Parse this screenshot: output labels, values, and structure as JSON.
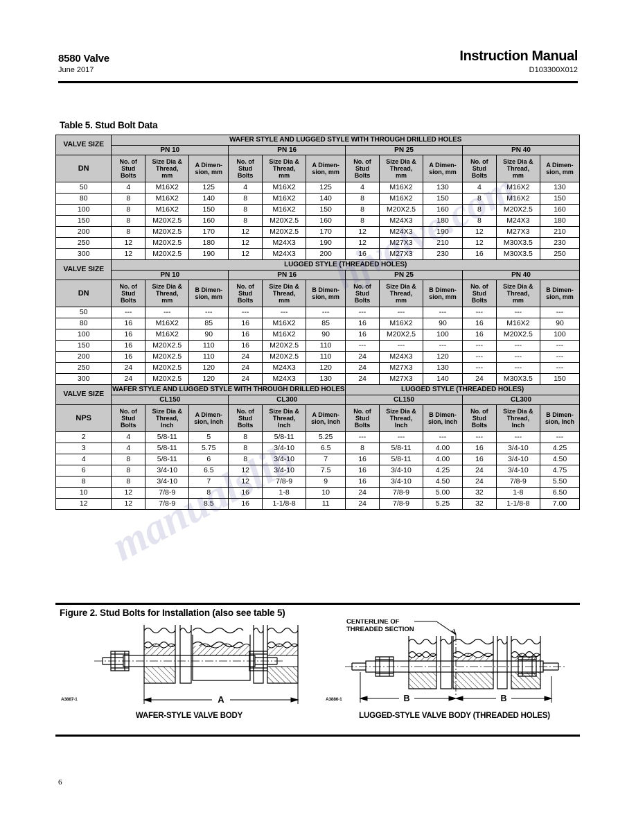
{
  "header": {
    "product": "8580 Valve",
    "date": "June 2017",
    "manual_title": "Instruction Manual",
    "doc_number": "D103300X012"
  },
  "table_caption": "Table 5. Stud Bolt Data",
  "labels": {
    "valve_size": "VALVE SIZE",
    "dn": "DN",
    "nps": "NPS",
    "no_of_stud_bolts": "No. of\nStud\nBolts",
    "size_dia_thread_mm": "Size Dia &\nThread,\nmm",
    "size_dia_thread_inch": "Size Dia &\nThread,\nInch",
    "a_dimension_mm": "A Dimen-\nsion, mm",
    "b_dimension_mm": "B Dimen-\nsion, mm",
    "a_dimension_inch": "A Dimen-\nsion, Inch",
    "b_dimension_inch": "B Dimen-\nsion, Inch",
    "banner_wafer_through": "WAFER STYLE AND LUGGED STYLE WITH THROUGH DRILLED HOLES",
    "banner_lugged_threaded": "LUGGED STYLE (THREADED HOLES)",
    "banner_wafer_through_wrapped": "WAFER STYLE AND LUGGED STYLE WITH THROUGH DRILLED HOLES"
  },
  "sections": [
    {
      "id": "metric-through-drilled",
      "banner": "WAFER STYLE AND LUGGED STYLE WITH THROUGH DRILLED HOLES",
      "size_label": "DN",
      "groups": [
        "PN 10",
        "PN 16",
        "PN 25",
        "PN 40"
      ],
      "sub_headers": [
        "No. of\nStud\nBolts",
        "Size Dia &\nThread,\nmm",
        "A Dimen-\nsion, mm"
      ],
      "rows": [
        [
          "50",
          "4",
          "M16X2",
          "125",
          "4",
          "M16X2",
          "125",
          "4",
          "M16X2",
          "130",
          "4",
          "M16X2",
          "130"
        ],
        [
          "80",
          "8",
          "M16X2",
          "140",
          "8",
          "M16X2",
          "140",
          "8",
          "M16X2",
          "150",
          "8",
          "M16X2",
          "150"
        ],
        [
          "100",
          "8",
          "M16X2",
          "150",
          "8",
          "M16X2",
          "150",
          "8",
          "M20X2.5",
          "160",
          "8",
          "M20X2.5",
          "160"
        ],
        [
          "150",
          "8",
          "M20X2.5",
          "160",
          "8",
          "M20X2.5",
          "160",
          "8",
          "M24X3",
          "180",
          "8",
          "M24X3",
          "180"
        ],
        [
          "200",
          "8",
          "M20X2.5",
          "170",
          "12",
          "M20X2.5",
          "170",
          "12",
          "M24X3",
          "190",
          "12",
          "M27X3",
          "210"
        ],
        [
          "250",
          "12",
          "M20X2.5",
          "180",
          "12",
          "M24X3",
          "190",
          "12",
          "M27X3",
          "210",
          "12",
          "M30X3.5",
          "230"
        ],
        [
          "300",
          "12",
          "M20X2.5",
          "190",
          "12",
          "M24X3",
          "200",
          "16",
          "M27X3",
          "230",
          "16",
          "M30X3.5",
          "250"
        ]
      ]
    },
    {
      "id": "metric-threaded-holes",
      "banner": "LUGGED STYLE (THREADED HOLES)",
      "size_label": "DN",
      "groups": [
        "PN 10",
        "PN 16",
        "PN 25",
        "PN 40"
      ],
      "sub_headers": [
        "No. of\nStud\nBolts",
        "Size Dia &\nThread,\nmm",
        "B Dimen-\nsion, mm"
      ],
      "rows": [
        [
          "50",
          "---",
          "---",
          "---",
          "---",
          "---",
          "---",
          "---",
          "---",
          "---",
          "---",
          "---",
          "---"
        ],
        [
          "80",
          "16",
          "M16X2",
          "85",
          "16",
          "M16X2",
          "85",
          "16",
          "M16X2",
          "90",
          "16",
          "M16X2",
          "90"
        ],
        [
          "100",
          "16",
          "M16X2",
          "90",
          "16",
          "M16X2",
          "90",
          "16",
          "M20X2.5",
          "100",
          "16",
          "M20X2.5",
          "100"
        ],
        [
          "150",
          "16",
          "M20X2.5",
          "110",
          "16",
          "M20X2.5",
          "110",
          "---",
          "---",
          "---",
          "---",
          "---",
          "---"
        ],
        [
          "200",
          "16",
          "M20X2.5",
          "110",
          "24",
          "M20X2.5",
          "110",
          "24",
          "M24X3",
          "120",
          "---",
          "---",
          "---"
        ],
        [
          "250",
          "24",
          "M20X2.5",
          "120",
          "24",
          "M24X3",
          "120",
          "24",
          "M27X3",
          "130",
          "---",
          "---",
          "---"
        ],
        [
          "300",
          "24",
          "M20X2.5",
          "120",
          "24",
          "M24X3",
          "130",
          "24",
          "M27X3",
          "140",
          "24",
          "M30X3.5",
          "150"
        ]
      ]
    },
    {
      "id": "imperial",
      "banner_left": "WAFER STYLE AND LUGGED STYLE WITH THROUGH DRILLED HOLES",
      "banner_right": "LUGGED STYLE (THREADED HOLES)",
      "size_label": "NPS",
      "groups": [
        "CL150",
        "CL300",
        "CL150",
        "CL300"
      ],
      "sub_headers_left": [
        "No. of\nStud\nBolts",
        "Size Dia &\nThread,\nInch",
        "A Dimen-\nsion, Inch"
      ],
      "sub_headers_right": [
        "No. of\nStud\nBolts",
        "Size Dia &\nThread,\nInch",
        "B Dimen-\nsion, Inch"
      ],
      "rows": [
        [
          "2",
          "4",
          "5/8-11",
          "5",
          "8",
          "5/8-11",
          "5.25",
          "---",
          "---",
          "---",
          "---",
          "---",
          "---"
        ],
        [
          "3",
          "4",
          "5/8-11",
          "5.75",
          "8",
          "3/4-10",
          "6.5",
          "8",
          "5/8-11",
          "4.00",
          "16",
          "3/4-10",
          "4.25"
        ],
        [
          "4",
          "8",
          "5/8-11",
          "6",
          "8",
          "3/4-10",
          "7",
          "16",
          "5/8-11",
          "4.00",
          "16",
          "3/4-10",
          "4.50"
        ],
        [
          "6",
          "8",
          "3/4-10",
          "6.5",
          "12",
          "3/4-10",
          "7.5",
          "16",
          "3/4-10",
          "4.25",
          "24",
          "3/4-10",
          "4.75"
        ],
        [
          "8",
          "8",
          "3/4-10",
          "7",
          "12",
          "7/8-9",
          "9",
          "16",
          "3/4-10",
          "4.50",
          "24",
          "7/8-9",
          "5.50"
        ],
        [
          "10",
          "12",
          "7/8-9",
          "8",
          "16",
          "1-8",
          "10",
          "24",
          "7/8-9",
          "5.00",
          "32",
          "1-8",
          "6.50"
        ],
        [
          "12",
          "12",
          "7/8-9",
          "8.5",
          "16",
          "1-1/8-8",
          "11",
          "24",
          "7/8-9",
          "5.25",
          "32",
          "1-1/8-8",
          "7.00"
        ]
      ]
    }
  ],
  "figure": {
    "caption": "Figure 2. Stud Bolts for Installation (also see table 5)",
    "left": {
      "label": "WAFER-STYLE VALVE BODY",
      "code": "A3887-1",
      "dimension_label": "A"
    },
    "right": {
      "label": "LUGGED-STYLE VALVE BODY (THREADED HOLES)",
      "code": "A3886-1",
      "callout_line1": "CENTERLINE OF",
      "callout_line2": "THREADED SECTION",
      "dimension_label_left": "B",
      "dimension_label_right": "B"
    }
  },
  "page_number": "6",
  "watermark": {
    "line1": "hjvalve.com",
    "line2": "manualslib"
  },
  "colors": {
    "header_gray": "#c9c9c9",
    "rule": "#000000",
    "watermark": "#2b2f86"
  }
}
